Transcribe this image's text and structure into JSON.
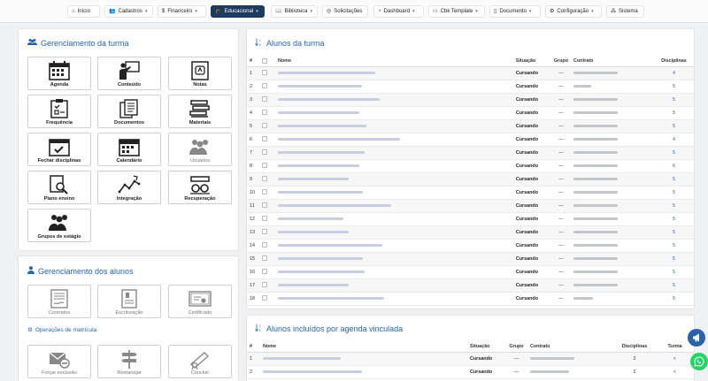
{
  "nav": [
    {
      "icon": "home-icon",
      "glyph": "⌂",
      "label": "Início",
      "caret": false,
      "active": false
    },
    {
      "icon": "users-icon",
      "glyph": "👥",
      "label": "Cadastros",
      "caret": true,
      "active": false
    },
    {
      "icon": "dollar-icon",
      "glyph": "$",
      "label": "Financeiro",
      "caret": true,
      "active": false
    },
    {
      "icon": "graduation-cap-icon",
      "glyph": "🎓",
      "label": "Educacional",
      "caret": true,
      "active": true
    },
    {
      "icon": "book-icon",
      "glyph": "📖",
      "label": "Biblioteca",
      "caret": true,
      "active": false
    },
    {
      "icon": "life-ring-icon",
      "glyph": "◎",
      "label": "Solicitações",
      "caret": false,
      "active": false
    },
    {
      "icon": "dashboard-icon",
      "glyph": "◔",
      "label": "Dashboard",
      "caret": true,
      "active": false
    },
    {
      "icon": "template-icon",
      "glyph": "▭",
      "label": "Cbk Template",
      "caret": true,
      "active": false
    },
    {
      "icon": "document-icon",
      "glyph": "▯",
      "label": "Documento",
      "caret": true,
      "active": false
    },
    {
      "icon": "gear-icon",
      "glyph": "⚙",
      "label": "Configuração",
      "caret": true,
      "active": false
    },
    {
      "icon": "grid-icon",
      "glyph": "⁂",
      "label": "Sistema",
      "caret": false,
      "active": false
    }
  ],
  "turma": {
    "title": "Gerenciamento da turma",
    "tiles": [
      {
        "label": "Agenda",
        "icon": "calendar-grid-icon",
        "muted": false
      },
      {
        "label": "Conteúdo",
        "icon": "teacher-board-icon",
        "muted": false
      },
      {
        "label": "Notas",
        "icon": "grade-sheet-icon",
        "muted": false
      },
      {
        "label": "Frequência",
        "icon": "checklist-icon",
        "muted": false
      },
      {
        "label": "Documentos",
        "icon": "documents-icon",
        "muted": false
      },
      {
        "label": "Materiais",
        "icon": "books-stack-icon",
        "muted": false
      },
      {
        "label": "Fechar disciplinas",
        "icon": "calendar-check-icon",
        "muted": false
      },
      {
        "label": "Calendário",
        "icon": "calendar-icon",
        "muted": false
      },
      {
        "label": "Usuários",
        "icon": "users-group-icon",
        "muted": true
      },
      {
        "label": "Plano ensino",
        "icon": "search-document-icon",
        "muted": false
      },
      {
        "label": "Integração",
        "icon": "line-chart-icon",
        "muted": false
      },
      {
        "label": "Recuperação",
        "icon": "glasses-book-icon",
        "muted": false
      },
      {
        "label": "Grupos de estágio",
        "icon": "people-group-icon",
        "muted": false
      }
    ]
  },
  "alunos_mgmt": {
    "title": "Gerenciamento dos alunos",
    "tiles": [
      {
        "label": "Contratos",
        "icon": "contract-icon",
        "muted": true
      },
      {
        "label": "Escrituração",
        "icon": "ledger-icon",
        "muted": true
      },
      {
        "label": "Certificado",
        "icon": "certificate-icon",
        "muted": true
      }
    ],
    "ops_title": "Operações de matrícula",
    "ops_tiles": [
      {
        "label": "Forçar exclusão",
        "icon": "mail-remove-icon",
        "muted": true
      },
      {
        "label": "Remanejar",
        "icon": "signpost-icon",
        "muted": true
      },
      {
        "label": "Concluir",
        "icon": "diploma-icon",
        "muted": true
      }
    ]
  },
  "alunos_turma": {
    "title": "Alunos da turma",
    "columns": [
      "#",
      "",
      "Nome",
      "Situação",
      "Grupo",
      "Contrato",
      "Disciplinas"
    ],
    "rows": [
      {
        "n": "1",
        "situacao": "Cursando",
        "grupo": "—",
        "disc": "4"
      },
      {
        "n": "2",
        "situacao": "Cursando",
        "grupo": "—",
        "disc": "5"
      },
      {
        "n": "3",
        "situacao": "Cursando",
        "grupo": "—",
        "disc": "5"
      },
      {
        "n": "4",
        "situacao": "Cursando",
        "grupo": "—",
        "disc": "5"
      },
      {
        "n": "5",
        "situacao": "Cursando",
        "grupo": "—",
        "disc": "5"
      },
      {
        "n": "6",
        "situacao": "Cursando",
        "grupo": "—",
        "disc": "4"
      },
      {
        "n": "7",
        "situacao": "Cursando",
        "grupo": "—",
        "disc": "5"
      },
      {
        "n": "8",
        "situacao": "Cursando",
        "grupo": "—",
        "disc": "6"
      },
      {
        "n": "9",
        "situacao": "Cursando",
        "grupo": "—",
        "disc": "5"
      },
      {
        "n": "10",
        "situacao": "Cursando",
        "grupo": "—",
        "disc": "5"
      },
      {
        "n": "11",
        "situacao": "Cursando",
        "grupo": "—",
        "disc": "5"
      },
      {
        "n": "12",
        "situacao": "Cursando",
        "grupo": "—",
        "disc": "5"
      },
      {
        "n": "13",
        "situacao": "Cursando",
        "grupo": "—",
        "disc": "5"
      },
      {
        "n": "14",
        "situacao": "Cursando",
        "grupo": "—",
        "disc": "5"
      },
      {
        "n": "15",
        "situacao": "Cursando",
        "grupo": "—",
        "disc": "5"
      },
      {
        "n": "16",
        "situacao": "Cursando",
        "grupo": "—",
        "disc": "5"
      },
      {
        "n": "17",
        "situacao": "Cursando",
        "grupo": "—",
        "disc": "5"
      },
      {
        "n": "18",
        "situacao": "Cursando",
        "grupo": "—",
        "disc": "5"
      }
    ]
  },
  "agenda_vinculada": {
    "title": "Alunos incluídos por agenda vinculada",
    "columns": [
      "#",
      "Nome",
      "Situação",
      "Grupo",
      "Contrato",
      "Disciplinas",
      "Turma"
    ],
    "rows": [
      {
        "n": "1",
        "situacao": "Cursando",
        "grupo": "—",
        "disc": "2"
      },
      {
        "n": "2",
        "situacao": "Cursando",
        "grupo": "—",
        "disc": "2"
      }
    ]
  },
  "colors": {
    "accent": "#2a64a8",
    "nav_active": "#1d3a5f",
    "whatsapp": "#25d366",
    "megaphone": "#2a64a8"
  }
}
